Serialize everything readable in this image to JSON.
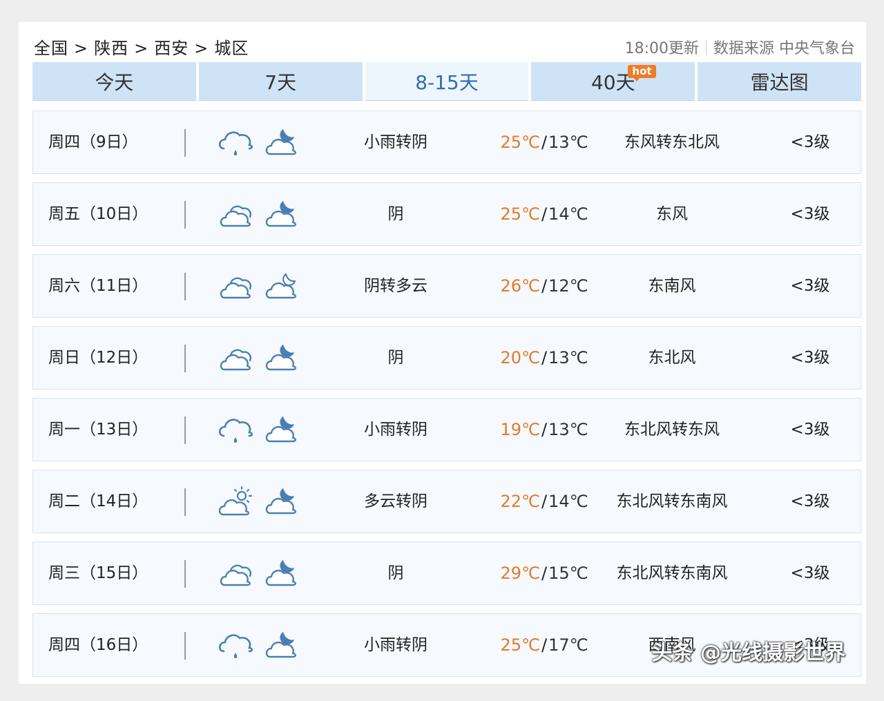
{
  "breadcrumb": [
    "全国",
    "陕西",
    "西安",
    "城区"
  ],
  "breadcrumb_sep": ">",
  "update_time": "18:00更新",
  "data_source": "数据来源 中央气象台",
  "tabs": [
    {
      "label": "今天",
      "active": false
    },
    {
      "label": "7天",
      "active": false
    },
    {
      "label": "8-15天",
      "active": true
    },
    {
      "label": "40天",
      "active": false,
      "badge": "hot"
    },
    {
      "label": "雷达图",
      "active": false
    }
  ],
  "colors": {
    "high_temp": "#e07b2c",
    "icon": "#4a7fb3",
    "active_tab": "#2f6db3"
  },
  "forecast": [
    {
      "date": "周四（9日）",
      "day_icon": "light-rain-icon",
      "night_icon": "cloudy-night-icon",
      "condition": "小雨转阴",
      "high": "25℃",
      "low": "13℃",
      "wind": "东风转东北风",
      "level": "<3级"
    },
    {
      "date": "周五（10日）",
      "day_icon": "overcast-icon",
      "night_icon": "cloudy-night-icon",
      "condition": "阴",
      "high": "25℃",
      "low": "14℃",
      "wind": "东风",
      "level": "<3级"
    },
    {
      "date": "周六（11日）",
      "day_icon": "overcast-icon",
      "night_icon": "partly-cloudy-night-icon",
      "condition": "阴转多云",
      "high": "26℃",
      "low": "12℃",
      "wind": "东南风",
      "level": "<3级"
    },
    {
      "date": "周日（12日）",
      "day_icon": "overcast-icon",
      "night_icon": "cloudy-night-icon",
      "condition": "阴",
      "high": "20℃",
      "low": "13℃",
      "wind": "东北风",
      "level": "<3级"
    },
    {
      "date": "周一（13日）",
      "day_icon": "light-rain-icon",
      "night_icon": "cloudy-night-icon",
      "condition": "小雨转阴",
      "high": "19℃",
      "low": "13℃",
      "wind": "东北风转东风",
      "level": "<3级"
    },
    {
      "date": "周二（14日）",
      "day_icon": "partly-cloudy-day-icon",
      "night_icon": "cloudy-night-icon",
      "condition": "多云转阴",
      "high": "22℃",
      "low": "14℃",
      "wind": "东北风转东南风",
      "level": "<3级"
    },
    {
      "date": "周三（15日）",
      "day_icon": "overcast-icon",
      "night_icon": "cloudy-night-icon",
      "condition": "阴",
      "high": "29℃",
      "low": "15℃",
      "wind": "东北风转东南风",
      "level": "<3级"
    },
    {
      "date": "周四（16日）",
      "day_icon": "light-rain-icon",
      "night_icon": "cloudy-night-icon",
      "condition": "小雨转阴",
      "high": "25℃",
      "low": "17℃",
      "wind": "西南风",
      "level": "<3级"
    }
  ],
  "watermark": "头条 @光线摄影世界"
}
